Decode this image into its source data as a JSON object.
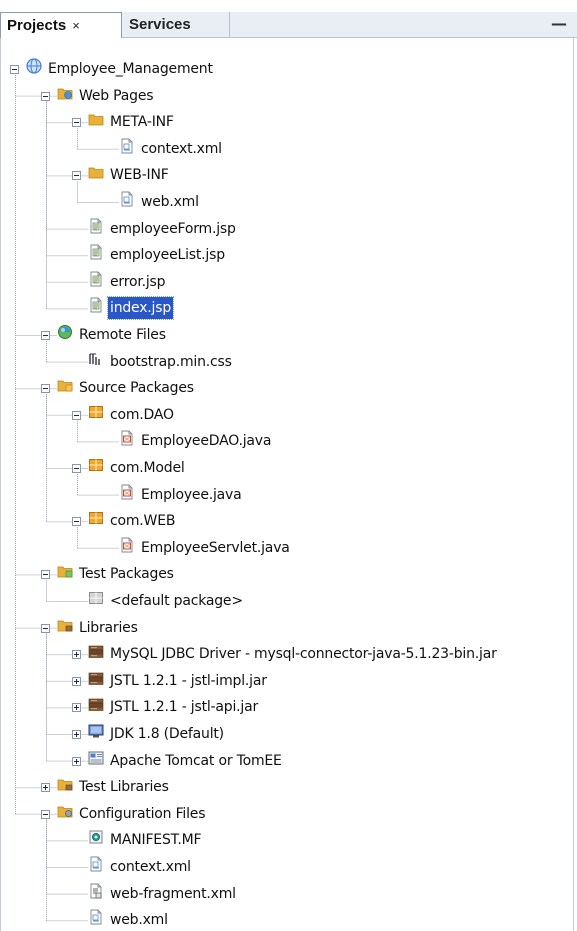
{
  "tabs": {
    "projects": "Projects",
    "close_glyph": "×",
    "services": "Services",
    "minimize_glyph": "—"
  },
  "tree": [
    {
      "label": "Employee_Management",
      "depth": 0,
      "icon": "project-globe-icon",
      "expanded": true
    },
    {
      "label": "Web Pages",
      "depth": 1,
      "icon": "web-pages-folder-icon",
      "expanded": true
    },
    {
      "label": "META-INF",
      "depth": 2,
      "icon": "folder-icon",
      "expanded": true
    },
    {
      "label": "context.xml",
      "depth": 3,
      "icon": "xml-file-icon"
    },
    {
      "label": "WEB-INF",
      "depth": 2,
      "icon": "folder-icon",
      "expanded": true
    },
    {
      "label": "web.xml",
      "depth": 3,
      "icon": "xml-file-icon"
    },
    {
      "label": "employeeForm.jsp",
      "depth": 2,
      "icon": "jsp-file-icon"
    },
    {
      "label": "employeeList.jsp",
      "depth": 2,
      "icon": "jsp-file-icon"
    },
    {
      "label": "error.jsp",
      "depth": 2,
      "icon": "jsp-file-icon"
    },
    {
      "label": "index.jsp",
      "depth": 2,
      "icon": "jsp-file-icon",
      "selected": true
    },
    {
      "label": "Remote Files",
      "depth": 1,
      "icon": "remote-files-icon",
      "expanded": true
    },
    {
      "label": "bootstrap.min.css",
      "depth": 2,
      "icon": "css-file-icon"
    },
    {
      "label": "Source Packages",
      "depth": 1,
      "icon": "source-packages-folder-icon",
      "expanded": true
    },
    {
      "label": "com.DAO",
      "depth": 2,
      "icon": "package-icon",
      "expanded": true
    },
    {
      "label": "EmployeeDAO.java",
      "depth": 3,
      "icon": "java-file-icon"
    },
    {
      "label": "com.Model",
      "depth": 2,
      "icon": "package-icon",
      "expanded": true
    },
    {
      "label": "Employee.java",
      "depth": 3,
      "icon": "java-file-icon"
    },
    {
      "label": "com.WEB",
      "depth": 2,
      "icon": "package-icon",
      "expanded": true
    },
    {
      "label": "EmployeeServlet.java",
      "depth": 3,
      "icon": "java-file-icon"
    },
    {
      "label": "Test Packages",
      "depth": 1,
      "icon": "test-packages-folder-icon",
      "expanded": true
    },
    {
      "label": "<default package>",
      "depth": 2,
      "icon": "empty-package-icon"
    },
    {
      "label": "Libraries",
      "depth": 1,
      "icon": "libraries-folder-icon",
      "expanded": true
    },
    {
      "label": "MySQL JDBC Driver - mysql-connector-java-5.1.23-bin.jar",
      "depth": 2,
      "icon": "jar-library-icon",
      "expanded": false
    },
    {
      "label": "JSTL 1.2.1 - jstl-impl.jar",
      "depth": 2,
      "icon": "jar-library-icon",
      "expanded": false
    },
    {
      "label": "JSTL 1.2.1 - jstl-api.jar",
      "depth": 2,
      "icon": "jar-library-icon",
      "expanded": false
    },
    {
      "label": "JDK 1.8 (Default)",
      "depth": 2,
      "icon": "jdk-monitor-icon",
      "expanded": false
    },
    {
      "label": "Apache Tomcat or TomEE",
      "depth": 2,
      "icon": "server-icon",
      "expanded": false
    },
    {
      "label": "Test Libraries",
      "depth": 1,
      "icon": "test-libraries-folder-icon",
      "expanded": false
    },
    {
      "label": "Configuration Files",
      "depth": 1,
      "icon": "configuration-files-folder-icon",
      "expanded": true
    },
    {
      "label": "MANIFEST.MF",
      "depth": 2,
      "icon": "manifest-file-icon"
    },
    {
      "label": "context.xml",
      "depth": 2,
      "icon": "xml-file-icon"
    },
    {
      "label": "web-fragment.xml",
      "depth": 2,
      "icon": "xml-fragment-file-icon"
    },
    {
      "label": "web.xml",
      "depth": 2,
      "icon": "xml-file-icon"
    }
  ],
  "colors": {
    "folder": "#e8b23a",
    "folder_dark": "#b88418",
    "selection": "#2a57c6",
    "package": "#f0a830",
    "java": "#c0392b",
    "globe": "#3d7fd6"
  }
}
